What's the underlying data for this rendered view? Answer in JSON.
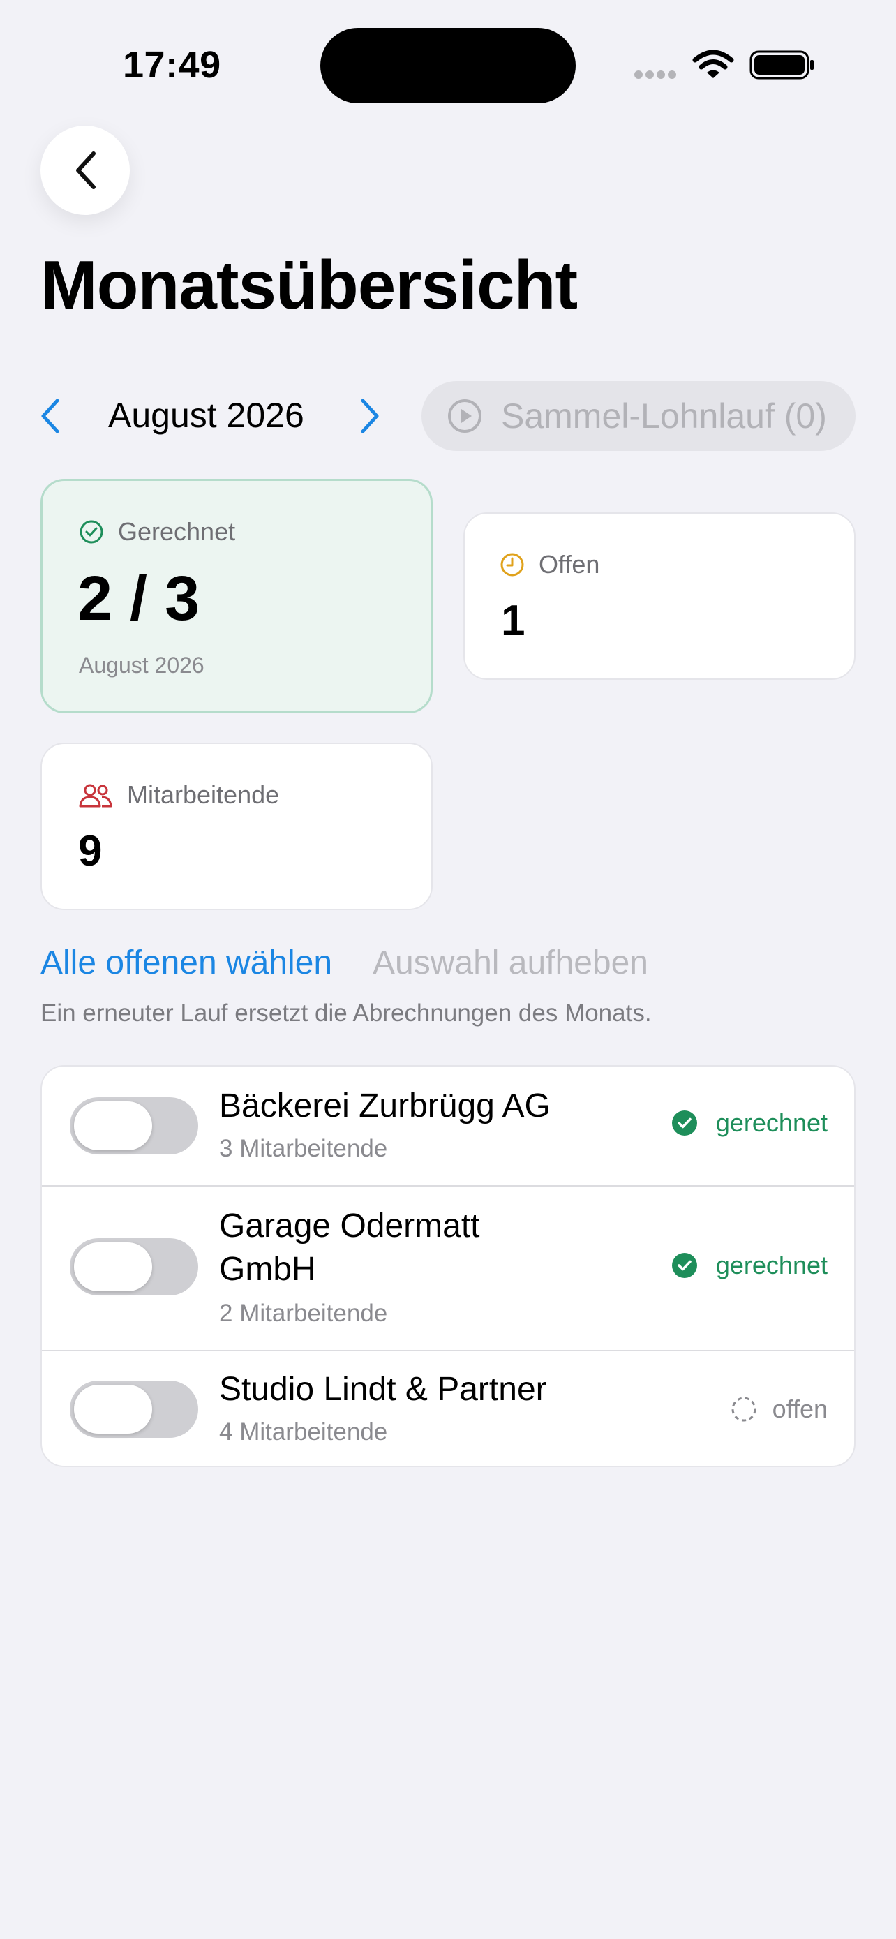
{
  "status_bar": {
    "time": "17:49"
  },
  "header": {
    "title": "Monatsübersicht"
  },
  "month_nav": {
    "label": "August 2026"
  },
  "batch_run": {
    "label": "Sammel-Lohnlauf (0)"
  },
  "stats": {
    "computed": {
      "label": "Gerechnet",
      "value": "2 / 3",
      "caption": "August 2026",
      "accent": "#1e8e5a"
    },
    "open": {
      "label": "Offen",
      "value": "1",
      "accent": "#e0a21c"
    },
    "employees": {
      "label": "Mitarbeitende",
      "value": "9",
      "accent": "#c8343b"
    }
  },
  "selection": {
    "select_all_open": "Alle offenen wählen",
    "clear_selection": "Auswahl aufheben",
    "hint": "Ein erneuter Lauf ersetzt die Abrechnungen des Monats."
  },
  "companies": [
    {
      "name": "Bäckerei Zurbrügg AG",
      "employees": "3 Mitarbeitende",
      "status": "gerechnet",
      "selected": false
    },
    {
      "name": "Garage Odermatt GmbH",
      "employees": "2 Mitarbeitende",
      "status": "gerechnet",
      "selected": false
    },
    {
      "name": "Studio Lindt & Partner",
      "employees": "4 Mitarbeitende",
      "status": "offen",
      "selected": false
    }
  ]
}
